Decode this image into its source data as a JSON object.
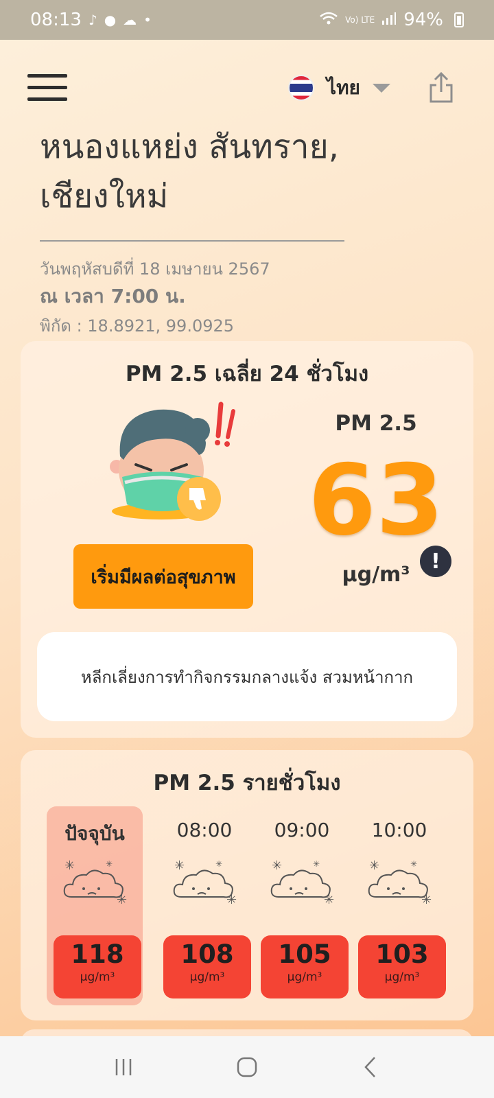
{
  "status_bar": {
    "time": "08:13",
    "network": "Vo) LTE",
    "battery": "94%"
  },
  "header": {
    "language_label": "ไทย",
    "language_flag": "thailand-flag-icon"
  },
  "location": {
    "title": "หนองแหย่ง สันทราย, เชียงใหม่",
    "date": "วันพฤหัสบดีที่ 18 เมษายน 2567",
    "time": "ณ เวลา 7:00 น.",
    "coordinates": "พิกัด : 18.8921, 99.0925"
  },
  "daily": {
    "title": "PM 2.5 เฉลี่ย 24 ชั่วโมง",
    "status_label": "เริ่มมีผลต่อสุขภาพ",
    "pm_label": "PM 2.5",
    "pm_value": "63",
    "unit": "µg/m³",
    "advice": "หลีกเลี่ยงการทำกิจกรรมกลางแจ้ง สวมหน้ากาก",
    "status_color": "#ff9a0e"
  },
  "hourly": {
    "title": "PM 2.5 รายชั่วโมง",
    "unit": "µg/m³",
    "items": [
      {
        "label": "ปัจจุบัน",
        "value": "118"
      },
      {
        "label": "08:00",
        "value": "108"
      },
      {
        "label": "09:00",
        "value": "105"
      },
      {
        "label": "10:00",
        "value": "103"
      }
    ],
    "badge_color": "#f44434"
  }
}
